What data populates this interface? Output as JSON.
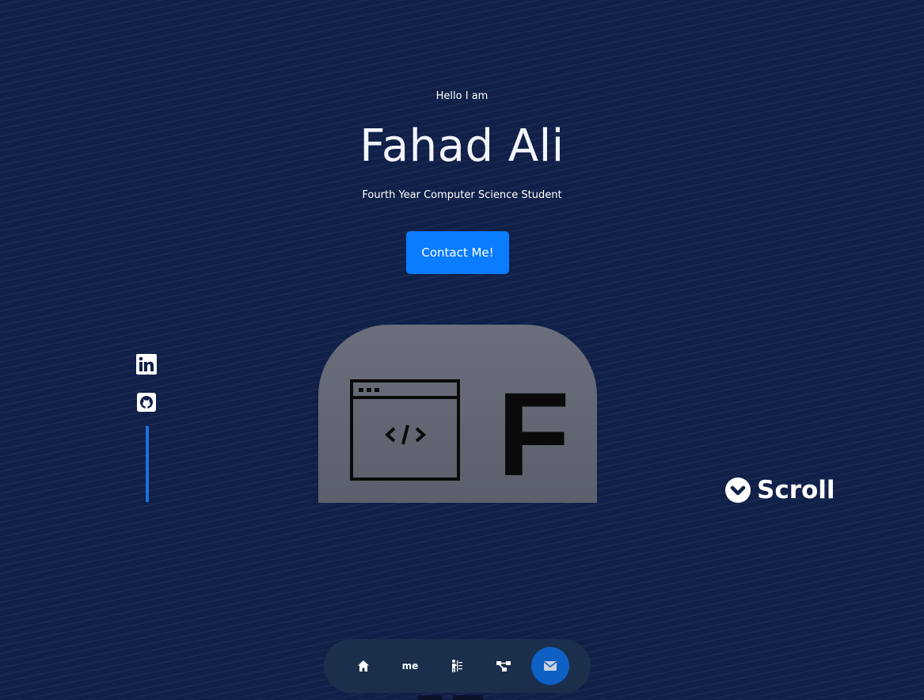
{
  "hero": {
    "greeting": "Hello I am",
    "name": "Fahad Ali",
    "subtitle": "Fourth Year Computer Science Student",
    "cta_label": "Contact Me!"
  },
  "logo": {
    "letter": "F",
    "code_glyph": "</>"
  },
  "social": {
    "items": [
      {
        "name": "linkedin-icon"
      },
      {
        "name": "github-icon"
      }
    ]
  },
  "scroll": {
    "label": "Scroll"
  },
  "nav": {
    "items": [
      {
        "name": "home-icon",
        "label": ""
      },
      {
        "name": "about-me",
        "label": "me"
      },
      {
        "name": "presentation-icon",
        "label": ""
      },
      {
        "name": "hierarchy-icon",
        "label": ""
      },
      {
        "name": "mail-icon",
        "label": "",
        "active": true
      }
    ]
  },
  "colors": {
    "background": "#102049",
    "accent": "#0a7cff",
    "nav_bg": "#1b2f4c",
    "nav_active": "#0e60c5",
    "card": "#5f6370"
  }
}
